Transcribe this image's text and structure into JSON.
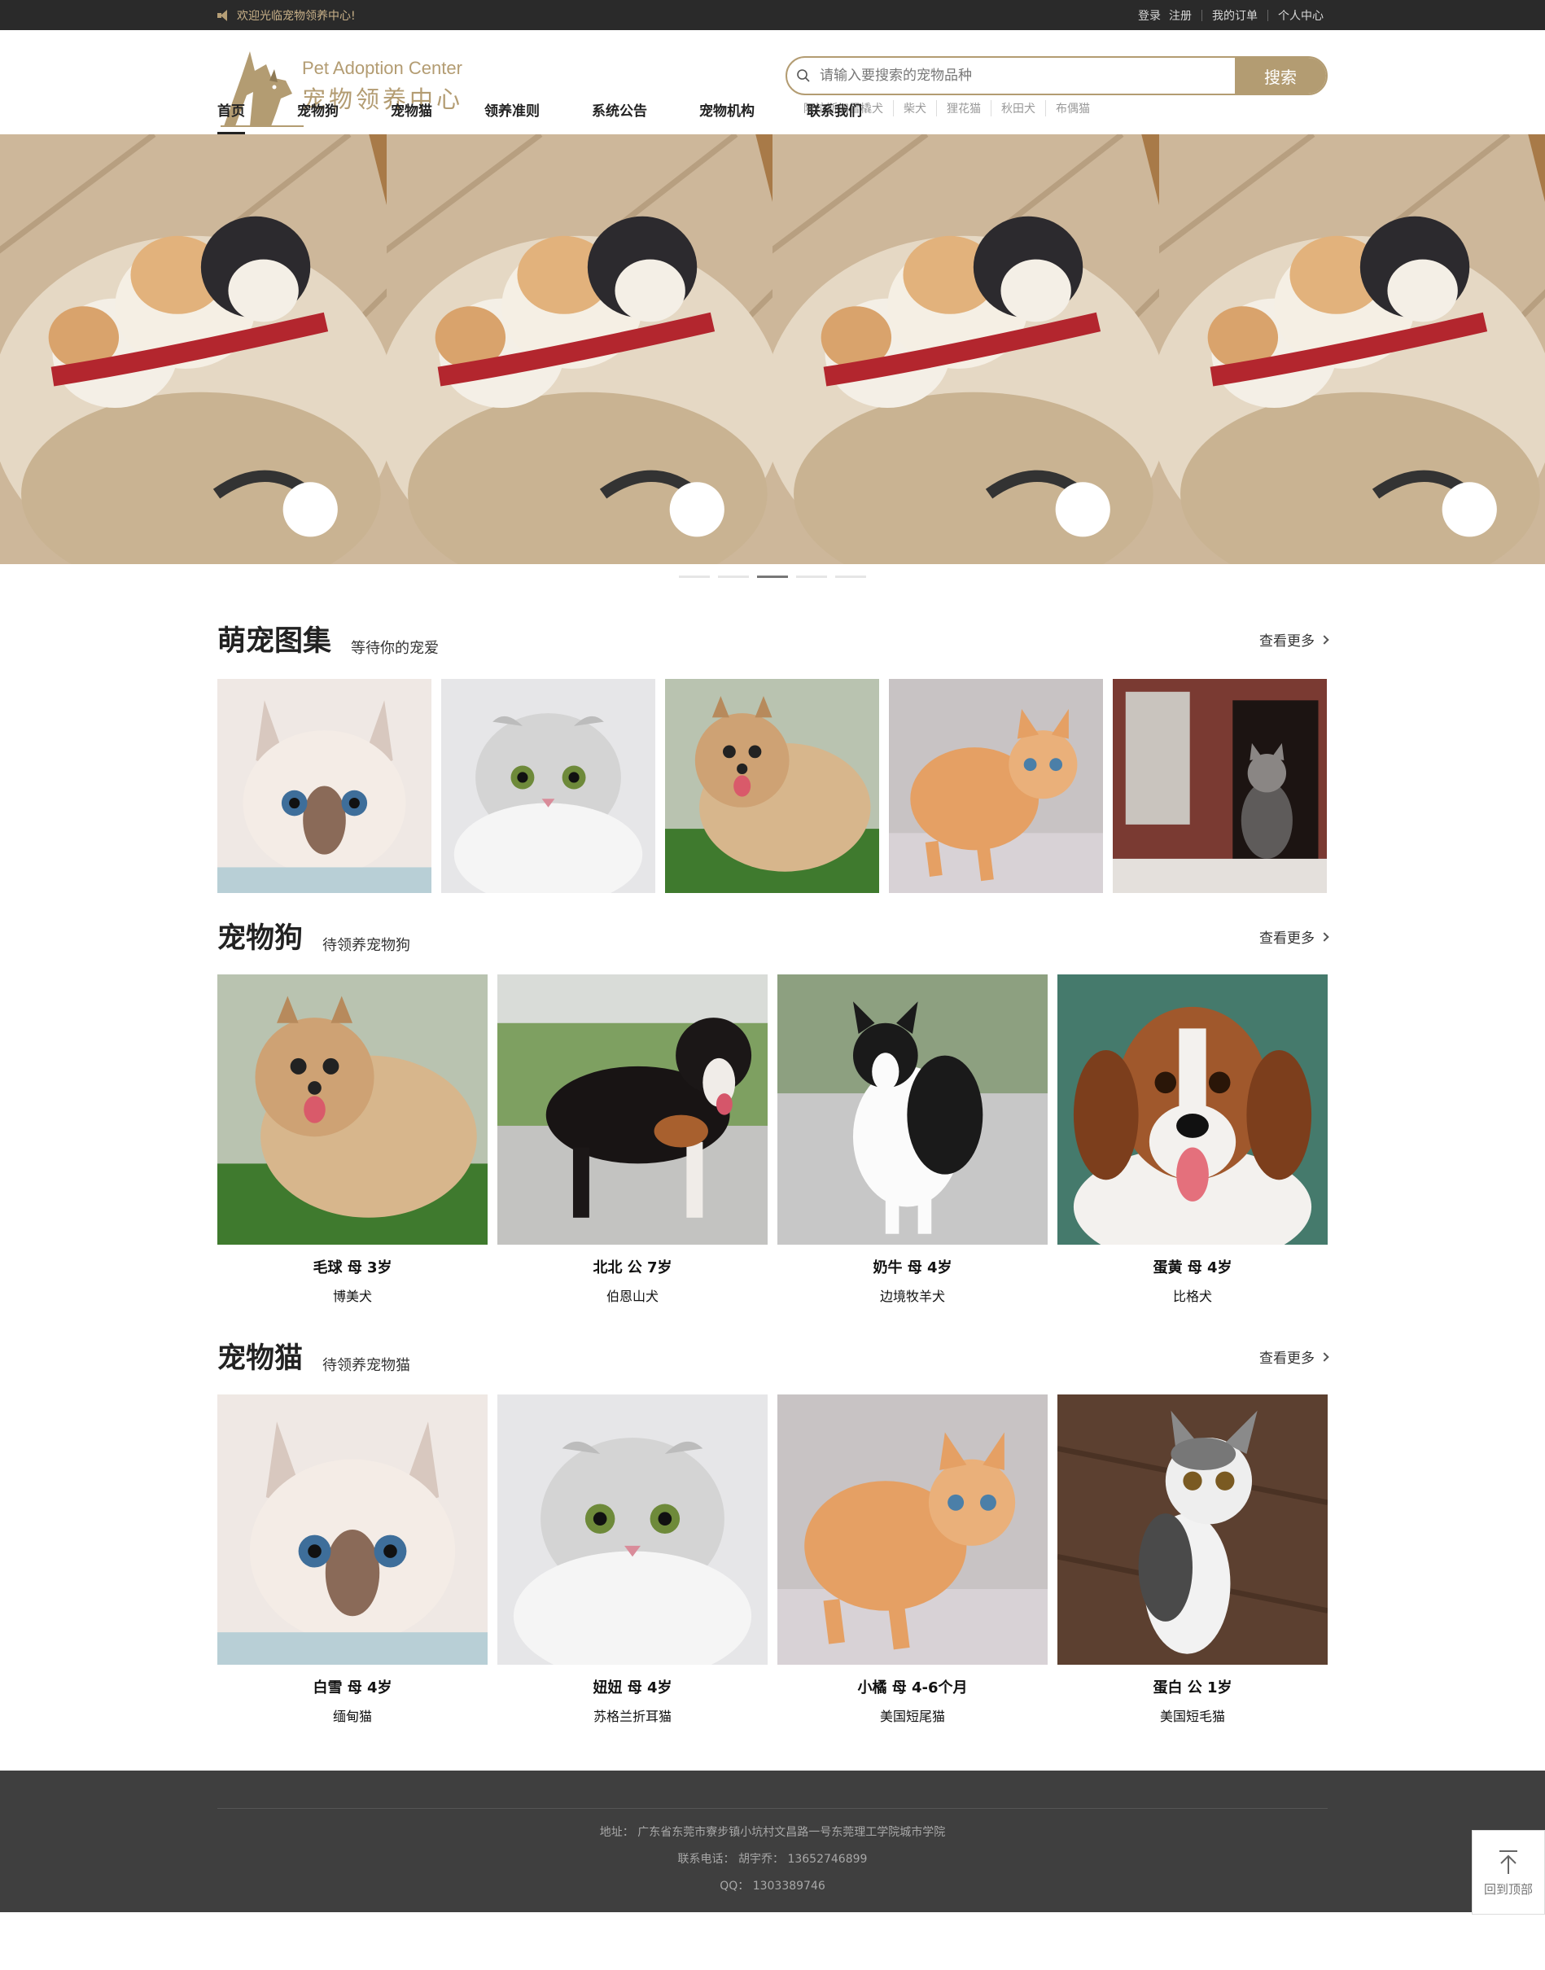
{
  "topbar": {
    "welcome": "欢迎光临宠物领养中心!",
    "links": [
      "登录",
      "注册",
      "我的订单",
      "个人中心"
    ]
  },
  "logo": {
    "en": "Pet Adoption Center",
    "cn": "宠物领养中心"
  },
  "search": {
    "placeholder": "请输入要搜索的宠物品种",
    "button": "搜索",
    "hot": [
      "阿拉斯加雪橇犬",
      "柴犬",
      "狸花猫",
      "秋田犬",
      "布偶猫"
    ]
  },
  "nav": [
    "首页",
    "宠物狗",
    "宠物猫",
    "领养准则",
    "系统公告",
    "宠物机构",
    "联系我们"
  ],
  "banner": {
    "slide_count": 5,
    "active_slide": 3
  },
  "gallery": {
    "title": "萌宠图集",
    "subtitle": "等待你的宠爱",
    "more": "查看更多"
  },
  "dogs": {
    "title": "宠物狗",
    "subtitle": "待领养宠物狗",
    "more": "查看更多",
    "items": [
      {
        "name": "毛球 母 3岁",
        "breed": "博美犬"
      },
      {
        "name": "北北 公 7岁",
        "breed": "伯恩山犬"
      },
      {
        "name": "奶牛 母 4岁",
        "breed": "边境牧羊犬"
      },
      {
        "name": "蛋黄 母 4岁",
        "breed": "比格犬"
      }
    ]
  },
  "cats": {
    "title": "宠物猫",
    "subtitle": "待领养宠物猫",
    "more": "查看更多",
    "items": [
      {
        "name": "白雪 母 4岁",
        "breed": "缅甸猫"
      },
      {
        "name": "妞妞 母 4岁",
        "breed": "苏格兰折耳猫"
      },
      {
        "name": "小橘 母 4-6个月",
        "breed": "美国短尾猫"
      },
      {
        "name": "蛋白 公 1岁",
        "breed": "美国短毛猫"
      }
    ]
  },
  "footer": {
    "address": "地址： 广东省东莞市寮步镇小坑村文昌路一号东莞理工学院城市学院",
    "phone": "联系电话： 胡宇乔： 13652746899",
    "qq": "QQ： 1303389746"
  },
  "back_to_top": "回到顶部",
  "colors": {
    "accent": "#b39c72",
    "topbar_bg": "#2a2a2a",
    "footer_bg": "#3f3f3f"
  }
}
